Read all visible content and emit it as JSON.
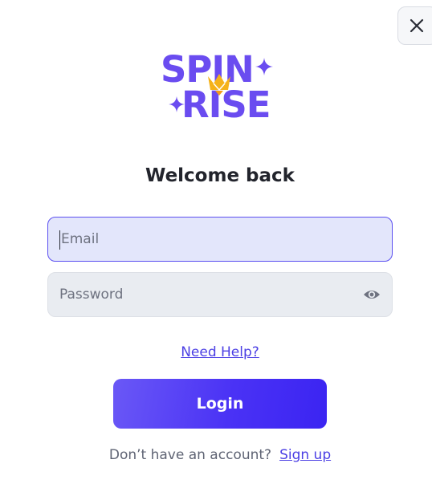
{
  "brand": {
    "line1": "SPIN",
    "line2": "RISE",
    "primary_color": "#6a4cf0",
    "crown_color": "#f5b21a"
  },
  "header": {
    "close_icon": "close-icon"
  },
  "form": {
    "title": "Welcome back",
    "email_placeholder": "Email",
    "password_placeholder": "Password",
    "password_toggle_icon": "eye-icon",
    "help_link": "Need Help?",
    "login_label": "Login",
    "signup_prompt": "Don’t have an account?",
    "signup_link": "Sign up"
  },
  "colors": {
    "accent": "#4b3fe4",
    "button_gradient_start": "#6a58f6",
    "button_gradient_end": "#3b24f2",
    "email_bg": "#e3e6fb",
    "password_bg": "#e9ecf1"
  }
}
